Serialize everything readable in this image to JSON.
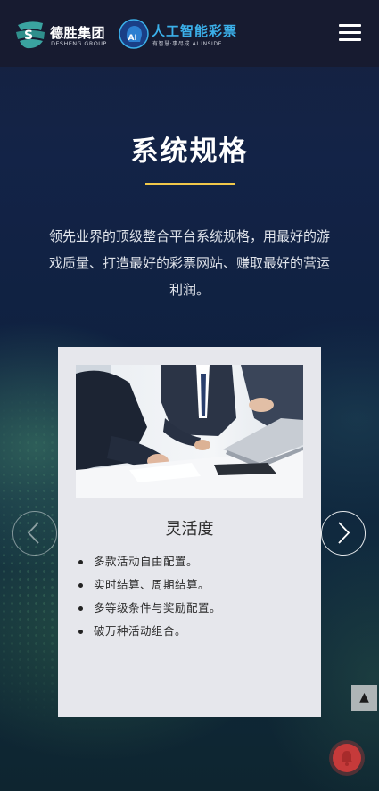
{
  "header": {
    "logo1_cn": "德胜集团",
    "logo1_en": "DESHENG GROUP",
    "logo2_cn": "人工智能彩票",
    "logo2_en": "有智慧·事尽成  AI INSIDE",
    "logo2_mark": "AI"
  },
  "section": {
    "title": "系统规格",
    "intro": "领先业界的顶级整合平台系统规格，用最好的游戏质量、打造最好的彩票网站、赚取最好的营运利润。"
  },
  "card": {
    "heading": "灵活度",
    "items": [
      "多款活动自由配置。",
      "实时结算、周期结算。",
      "多等级条件与奖励配置。",
      "破万种活动组合。"
    ]
  },
  "controls": {
    "back_top": "▲"
  },
  "colors": {
    "accent": "#f1c84a",
    "header_bg": "#171b30",
    "card_bg": "#e6e7ec",
    "logo2_blue": "#3bb0ea"
  }
}
